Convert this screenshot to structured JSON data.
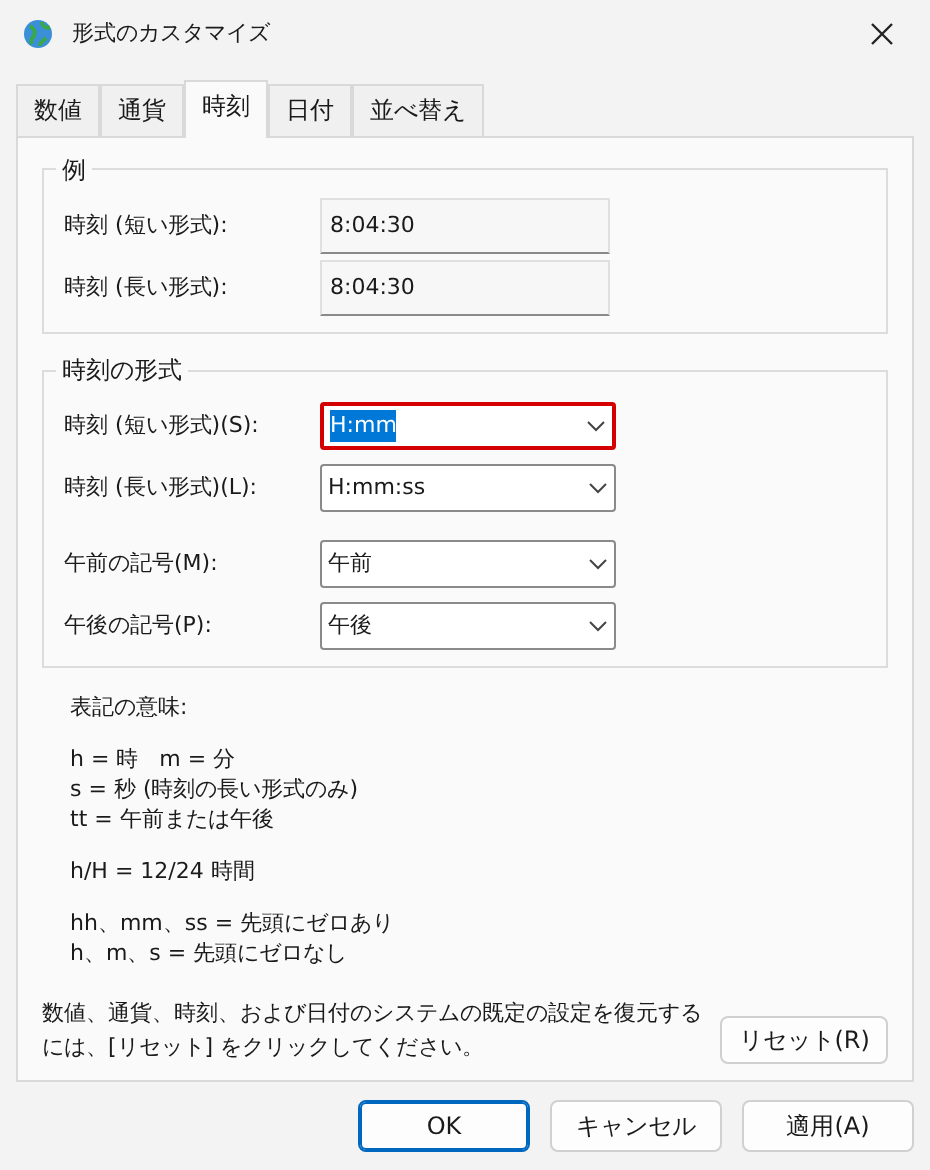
{
  "window": {
    "title": "形式のカスタマイズ"
  },
  "tabs": [
    {
      "label": "数値",
      "selected": false
    },
    {
      "label": "通貨",
      "selected": false
    },
    {
      "label": "時刻",
      "selected": true
    },
    {
      "label": "日付",
      "selected": false
    },
    {
      "label": "並べ替え",
      "selected": false
    }
  ],
  "example": {
    "legend": "例",
    "rows": [
      {
        "label": "時刻 (短い形式):",
        "value": "8:04:30"
      },
      {
        "label": "時刻 (長い形式):",
        "value": "8:04:30"
      }
    ]
  },
  "format": {
    "legend": "時刻の形式",
    "rows": [
      {
        "label": "時刻 (短い形式)(S):",
        "value": "H:mm",
        "focused": true
      },
      {
        "label": "時刻 (長い形式)(L):",
        "value": "H:mm:ss",
        "focused": false
      },
      {
        "label": "午前の記号(M):",
        "value": "午前",
        "focused": false
      },
      {
        "label": "午後の記号(P):",
        "value": "午後",
        "focused": false
      }
    ]
  },
  "notes": {
    "title": "表記の意味:",
    "groups": [
      [
        "h = 時   m = 分",
        "s = 秒 (時刻の長い形式のみ)",
        "tt = 午前または午後"
      ],
      [
        "h/H = 12/24 時間"
      ],
      [
        "hh、mm、ss = 先頭にゼロあり",
        "h、m、s = 先頭にゼロなし"
      ]
    ]
  },
  "reset": {
    "text": "数値、通貨、時刻、および日付のシステムの既定の設定を復元するには、[リセット] をクリックしてください。",
    "button": "リセット(R)"
  },
  "buttons": [
    {
      "label": "OK",
      "default": true
    },
    {
      "label": "キャンセル",
      "default": false
    },
    {
      "label": "適用(A)",
      "default": false
    }
  ]
}
